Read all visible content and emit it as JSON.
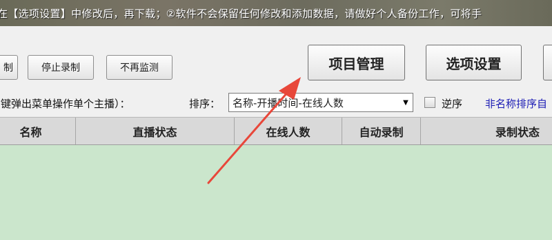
{
  "notice": {
    "text": "在【选项设置】中修改后，再下载；②软件不会保留任何修改和添加数据，请做好个人备份工作，可将手"
  },
  "toolbar": {
    "record_clipped_label": "制",
    "stop_record_label": "停止录制",
    "stop_monitor_label": "不再监测",
    "project_manage_label": "项目管理",
    "options_label": "选项设置"
  },
  "filter_row": {
    "hint": "右键弹出菜单操作单个主播）：",
    "sort_label": "排序：",
    "sort_selected": "名称-开播时间-在线人数",
    "reverse_label": "逆序",
    "reverse_checked": false,
    "extra_link": "非名称排序自"
  },
  "table": {
    "columns": [
      "名称",
      "直播状态",
      "在线人数",
      "自动录制",
      "录制状态"
    ],
    "rows": []
  },
  "colors": {
    "grid_background": "#cbe6cc",
    "annotation_arrow": "#e8473a",
    "link": "#1a1ab4"
  }
}
